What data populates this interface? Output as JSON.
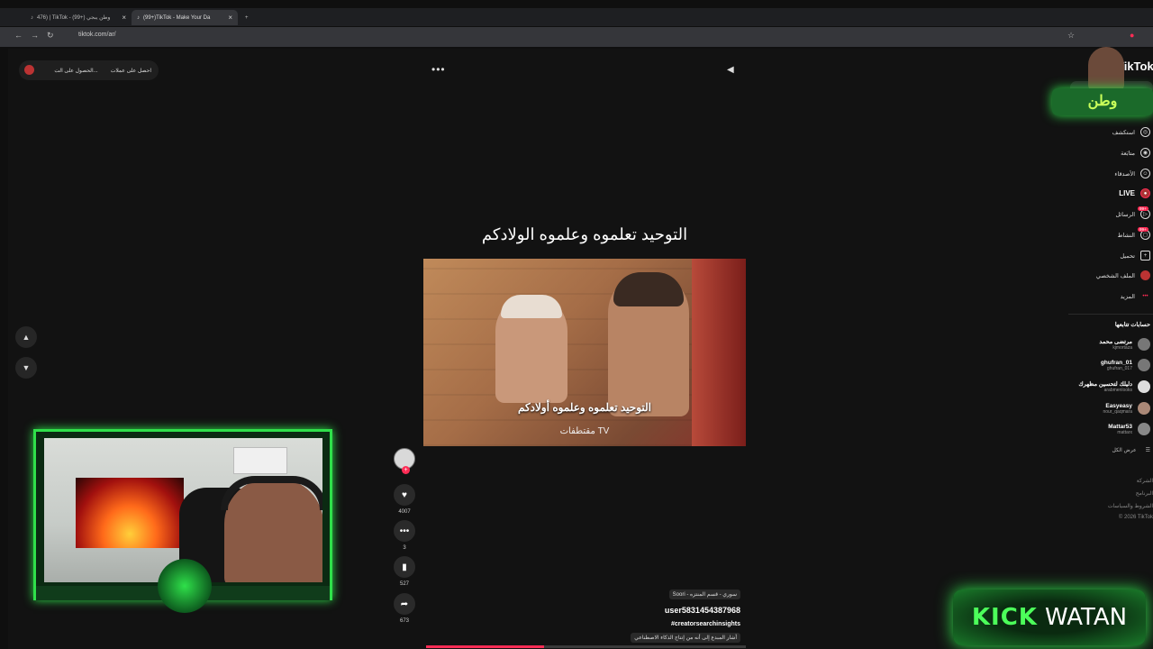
{
  "browser": {
    "tabs": [
      {
        "label": "476) | TikTok - وطن يبجي (+99)",
        "active": false
      },
      {
        "label": "(99+)TikTok - Make Your Da",
        "active": true
      }
    ],
    "url": "tiktok.com/ar/"
  },
  "top_bar": {
    "get_coins": "احصل على عملات",
    "get_app": "الحصول على الت..."
  },
  "video": {
    "title": "التوحيد تعلموه وعلموه الولادكم",
    "caption": "التوحيد تعلموه وعلموه أولادكم",
    "channel_watermark": "مقتطفات TV",
    "progress": 0.37,
    "likes": "4007",
    "comments": "3",
    "saves": "527",
    "shares": "673",
    "sound": "Soori - سوري - قسم المنتزه",
    "author": "user5831454387968",
    "hashtag": "#creatorsearchinsights",
    "ai_label": "أشار المبدع إلى أنه من إنتاج الذكاء الاصطناعي"
  },
  "sidebar": {
    "logo": "TikTok",
    "nav": [
      {
        "label": "استكشف",
        "icon": "compass-icon"
      },
      {
        "label": "متابَعة",
        "icon": "following-icon"
      },
      {
        "label": "الأصدقاء",
        "icon": "friends-icon"
      },
      {
        "label": "LIVE",
        "icon": "live-icon"
      },
      {
        "label": "الرسائل",
        "icon": "messages-icon",
        "badge": "99+"
      },
      {
        "label": "النشاط",
        "icon": "activity-icon",
        "badge": "99+"
      },
      {
        "label": "تحميل",
        "icon": "upload-icon"
      },
      {
        "label": "الملف الشخصي",
        "icon": "profile-icon"
      },
      {
        "label": "المزيد",
        "icon": "more-icon"
      }
    ],
    "following_header": "حسابات تتابعها",
    "following": [
      {
        "name": "مرتضى محمد",
        "handle": "kjmortaza"
      },
      {
        "name": "ghufran_01",
        "handle": "ghufran_017"
      },
      {
        "name": "دليلك لتحسين مظهرك",
        "handle": "arabmenlooks"
      },
      {
        "name": "Easyeasy",
        "handle": "nour_qaqmara"
      },
      {
        "name": "Mattar53",
        "handle": "mattarx"
      }
    ],
    "show_all": "عرض الكل",
    "footer": [
      "الشركة",
      "البرنامج",
      "الشروط والسياسات",
      "© 2026 TikTok"
    ]
  },
  "overlay": {
    "brand_text": "وطن",
    "kick": "KICK",
    "watan": "WATAN"
  },
  "colors": {
    "accent": "#fe2c55",
    "stream_green": "#2fe04a"
  }
}
